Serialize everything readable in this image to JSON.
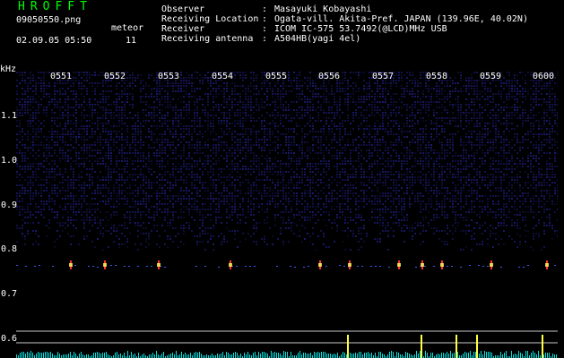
{
  "header": {
    "app_title": "HROFFT",
    "filename": "09050550.png",
    "meteor_label": "meteor",
    "timestamp": "02.09.05 05:50",
    "meteor_count": "11"
  },
  "info": [
    {
      "key": "Observer",
      "value": "Masayuki Kobayashi"
    },
    {
      "key": "Receiving Location",
      "value": "Ogata-vill. Akita-Pref. JAPAN (139.96E, 40.02N)"
    },
    {
      "key": "Receiver",
      "value": "ICOM IC-575 53.7492(@LCD)MHz USB"
    },
    {
      "key": "Receiving antenna",
      "value": "A504HB(yagi 4el)"
    }
  ],
  "axis": {
    "unit_label": "kHz",
    "time_labels": [
      "0551",
      "0552",
      "0553",
      "0554",
      "0555",
      "0556",
      "0557",
      "0558",
      "0559",
      "0600"
    ],
    "freq_labels": [
      "1.1",
      "1.0",
      "0.9",
      "0.8",
      "0.7",
      "0.6"
    ]
  },
  "colors": {
    "title": "#00ff00",
    "noise": "#1a1a6e",
    "echo": "#ff3030",
    "graph": "#00e0e0"
  }
}
